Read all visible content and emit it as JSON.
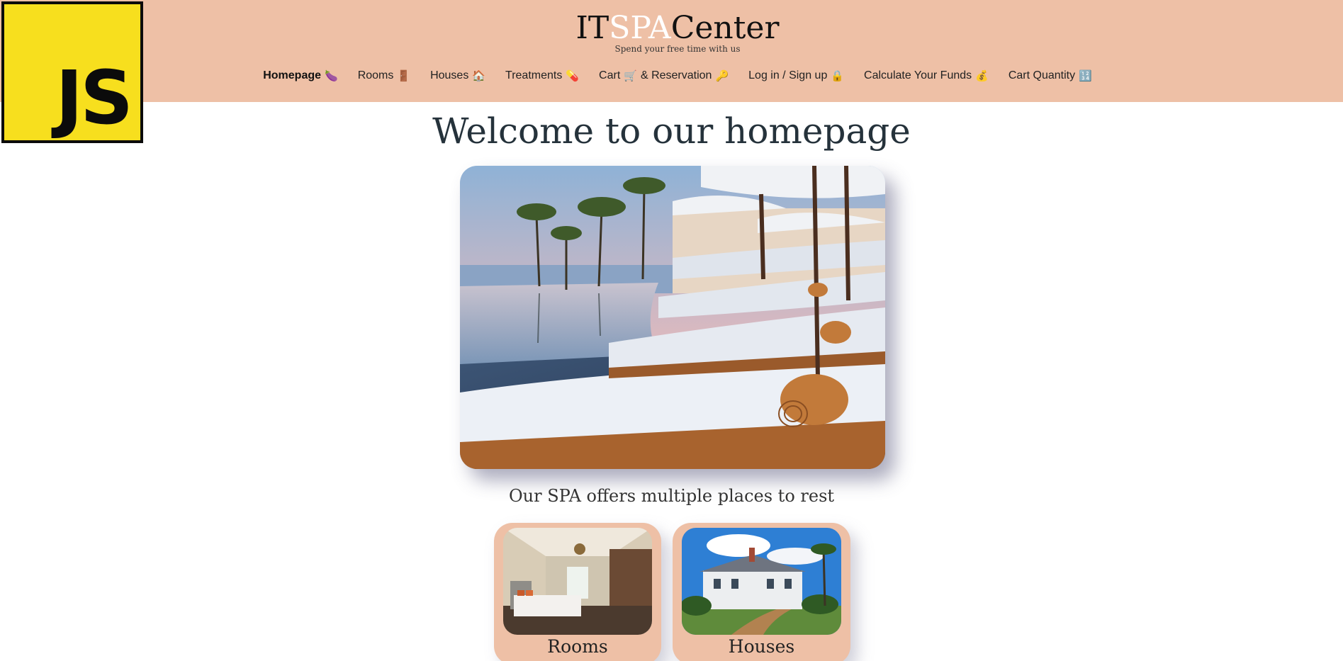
{
  "logo": {
    "text": "JS"
  },
  "header": {
    "brand_prefix": "IT",
    "brand_highlight": "SPA",
    "brand_suffix": "Center",
    "tagline": "Spend your free time with us",
    "nav": [
      {
        "label": "Homepage",
        "icon": "🍆",
        "active": true
      },
      {
        "label": "Rooms",
        "icon": "🚪"
      },
      {
        "label": "Houses",
        "icon": "🏠"
      },
      {
        "label": "Treatments",
        "icon": "💊"
      },
      {
        "label": "Cart",
        "icon": "🛒",
        "suffix": "& Reservation",
        "icon2": "🔑"
      },
      {
        "label": "Log in / Sign up",
        "icon": "🔒"
      },
      {
        "label": "Calculate Your Funds",
        "icon": "💰"
      },
      {
        "label": "Cart Quantity",
        "icon": "🔢"
      }
    ]
  },
  "main": {
    "title": "Welcome to our homepage",
    "subheading": "Our SPA offers multiple places to rest",
    "cards": [
      {
        "label": "Rooms"
      },
      {
        "label": "Houses"
      }
    ]
  },
  "colors": {
    "header_bg": "#eec0a6",
    "js_yellow": "#f7df1e",
    "brand_highlight": "#ffffff"
  }
}
